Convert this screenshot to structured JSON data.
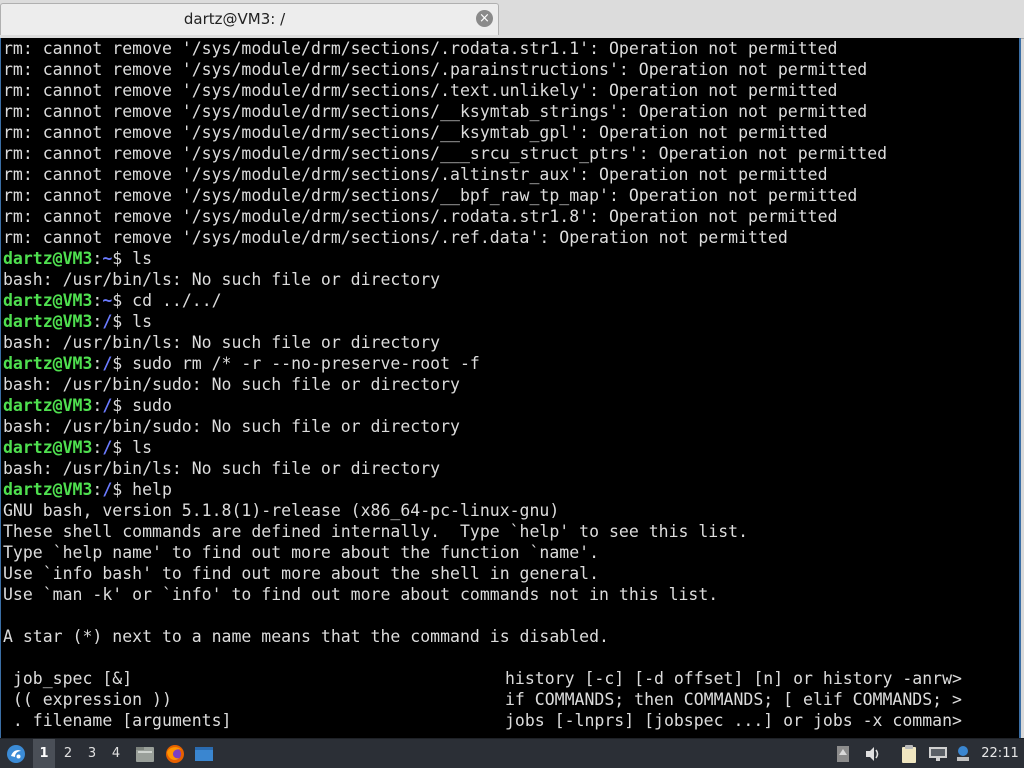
{
  "window": {
    "tab_title": "dartz@VM3: /",
    "close_glyph": "×"
  },
  "terminal": {
    "lines": [
      "rm: cannot remove '/sys/module/drm/sections/.rodata.str1.1': Operation not permitted",
      "rm: cannot remove '/sys/module/drm/sections/.parainstructions': Operation not permitted",
      "rm: cannot remove '/sys/module/drm/sections/.text.unlikely': Operation not permitted",
      "rm: cannot remove '/sys/module/drm/sections/__ksymtab_strings': Operation not permitted",
      "rm: cannot remove '/sys/module/drm/sections/__ksymtab_gpl': Operation not permitted",
      "rm: cannot remove '/sys/module/drm/sections/___srcu_struct_ptrs': Operation not permitted",
      "rm: cannot remove '/sys/module/drm/sections/.altinstr_aux': Operation not permitted",
      "rm: cannot remove '/sys/module/drm/sections/__bpf_raw_tp_map': Operation not permitted",
      "rm: cannot remove '/sys/module/drm/sections/.rodata.str1.8': Operation not permitted",
      "rm: cannot remove '/sys/module/drm/sections/.ref.data': Operation not permitted",
      "bash: /usr/bin/ls: No such file or directory",
      "bash: /usr/bin/ls: No such file or directory",
      "bash: /usr/bin/sudo: No such file or directory",
      "bash: /usr/bin/sudo: No such file or directory",
      "bash: /usr/bin/ls: No such file or directory",
      "GNU bash, version 5.1.8(1)-release (x86_64-pc-linux-gnu)",
      "These shell commands are defined internally.  Type `help' to see this list.",
      "Type `help name' to find out more about the function `name'.",
      "Use `info bash' to find out more about the shell in general.",
      "Use `man -k' or `info' to find out more about commands not in this list.",
      "A star (*) next to a name means that the command is disabled."
    ],
    "prompt_user": "dartz@VM3",
    "prompts": [
      {
        "path": "~",
        "cmd": " ls"
      },
      {
        "path": "~",
        "cmd": " cd ../../"
      },
      {
        "path": "/",
        "cmd": " ls"
      },
      {
        "path": "/",
        "cmd": " sudo rm /* -r --no-preserve-root -f"
      },
      {
        "path": "/",
        "cmd": " sudo"
      },
      {
        "path": "/",
        "cmd": " ls"
      },
      {
        "path": "/",
        "cmd": " help"
      }
    ],
    "help_left": [
      " job_spec [&]",
      " (( expression ))",
      " . filename [arguments]"
    ],
    "help_right": [
      "history [-c] [-d offset] [n] or history -anrw>",
      "if COMMANDS; then COMMANDS; [ elif COMMANDS; >",
      "jobs [-lnprs] [jobspec ...] or jobs -x comman>"
    ]
  },
  "taskbar": {
    "workspaces": [
      "1",
      "2",
      "3",
      "4"
    ],
    "active_workspace": "1",
    "clock": "22:11",
    "icons": [
      "start-menu-icon",
      "file-manager-icon",
      "firefox-icon",
      "window-icon",
      "updates-icon",
      "volume-icon",
      "clipboard-icon",
      "network-icon",
      "battery-icon"
    ]
  }
}
